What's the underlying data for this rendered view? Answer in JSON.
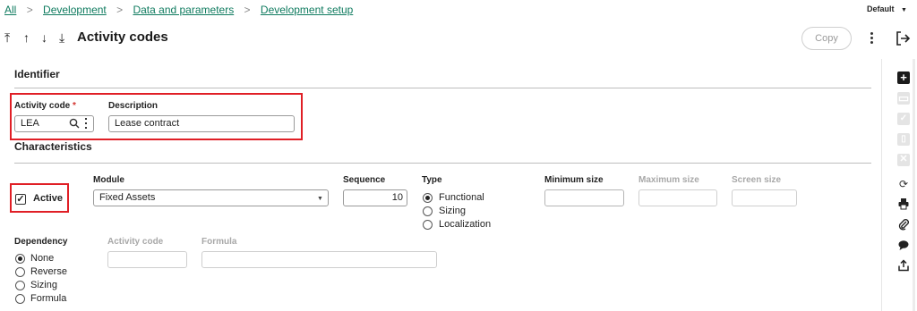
{
  "breadcrumb": {
    "items": [
      "All",
      "Development",
      "Data and parameters",
      "Development setup"
    ],
    "separator": ">"
  },
  "top_right": {
    "profile": "Default"
  },
  "header": {
    "title": "Activity codes",
    "copy_label": "Copy"
  },
  "identifier": {
    "section_title": "Identifier",
    "activity_code_label": "Activity code",
    "required_marker": "*",
    "activity_code_value": "LEA",
    "description_label": "Description",
    "description_value": "Lease contract"
  },
  "characteristics": {
    "section_title": "Characteristics",
    "active_label": "Active",
    "active_checked": true,
    "module_label": "Module",
    "module_value": "Fixed Assets",
    "sequence_label": "Sequence",
    "sequence_value": "10",
    "type_label": "Type",
    "type_options": [
      "Functional",
      "Sizing",
      "Localization"
    ],
    "type_selected": "Functional",
    "minimum_size_label": "Minimum size",
    "maximum_size_label": "Maximum size",
    "screen_size_label": "Screen size"
  },
  "dependency": {
    "label": "Dependency",
    "options": [
      "None",
      "Reverse",
      "Sizing",
      "Formula"
    ],
    "selected": "None",
    "activity_code_label": "Activity code",
    "formula_label": "Formula"
  },
  "colors": {
    "link": "#0f7b5f",
    "highlight": "#e01f26",
    "required": "#d3342f"
  },
  "icons": {
    "nav": [
      "first-icon",
      "previous-icon",
      "next-icon",
      "last-icon"
    ],
    "right_toolbar": [
      "add-icon",
      "save-icon",
      "check-icon",
      "delete-icon",
      "close-icon",
      "refresh-icon",
      "print-icon",
      "attachment-icon",
      "comment-icon",
      "export-icon"
    ]
  }
}
